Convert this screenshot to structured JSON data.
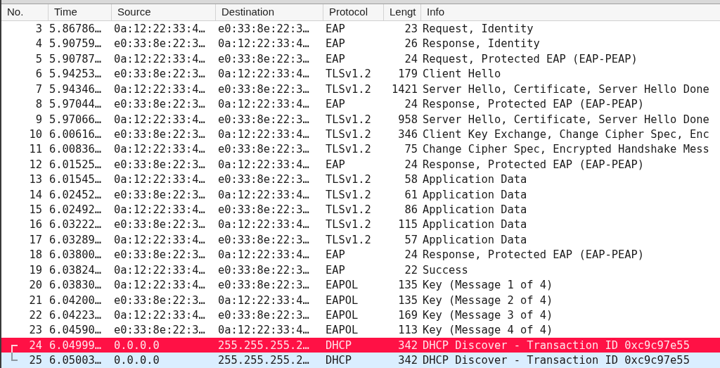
{
  "table": {
    "columns": [
      "No.",
      "Time",
      "Source",
      "Destination",
      "Protocol",
      "Lengt",
      "Info"
    ],
    "rows": [
      {
        "no": "3",
        "time": "5.86786…",
        "source": "0a:12:22:33:4…",
        "destination": "e0:33:8e:22:3…",
        "protocol": "EAP",
        "length": "23",
        "info": "Request, Identity",
        "selected": false,
        "color": "#ffffff"
      },
      {
        "no": "4",
        "time": "5.90759…",
        "source": "e0:33:8e:22:3…",
        "destination": "0a:12:22:33:4…",
        "protocol": "EAP",
        "length": "26",
        "info": "Response, Identity",
        "selected": false,
        "color": "#ffffff"
      },
      {
        "no": "5",
        "time": "5.90787…",
        "source": "0a:12:22:33:4…",
        "destination": "e0:33:8e:22:3…",
        "protocol": "EAP",
        "length": "24",
        "info": "Request, Protected EAP (EAP-PEAP)",
        "selected": false,
        "color": "#ffffff"
      },
      {
        "no": "6",
        "time": "5.94253…",
        "source": "e0:33:8e:22:3…",
        "destination": "0a:12:22:33:4…",
        "protocol": "TLSv1.2",
        "length": "179",
        "info": "Client Hello",
        "selected": false,
        "color": "#ffffff"
      },
      {
        "no": "7",
        "time": "5.94346…",
        "source": "0a:12:22:33:4…",
        "destination": "e0:33:8e:22:3…",
        "protocol": "TLSv1.2",
        "length": "1421",
        "info": "Server Hello, Certificate, Server Hello Done",
        "selected": false,
        "color": "#ffffff"
      },
      {
        "no": "8",
        "time": "5.97044…",
        "source": "e0:33:8e:22:3…",
        "destination": "0a:12:22:33:4…",
        "protocol": "EAP",
        "length": "24",
        "info": "Response, Protected EAP (EAP-PEAP)",
        "selected": false,
        "color": "#ffffff"
      },
      {
        "no": "9",
        "time": "5.97066…",
        "source": "0a:12:22:33:4…",
        "destination": "e0:33:8e:22:3…",
        "protocol": "TLSv1.2",
        "length": "958",
        "info": "Server Hello, Certificate, Server Hello Done",
        "selected": false,
        "color": "#ffffff"
      },
      {
        "no": "10",
        "time": "6.00616…",
        "source": "e0:33:8e:22:3…",
        "destination": "0a:12:22:33:4…",
        "protocol": "TLSv1.2",
        "length": "346",
        "info": "Client Key Exchange, Change Cipher Spec, Enc",
        "selected": false,
        "color": "#ffffff"
      },
      {
        "no": "11",
        "time": "6.00836…",
        "source": "0a:12:22:33:4…",
        "destination": "e0:33:8e:22:3…",
        "protocol": "TLSv1.2",
        "length": "75",
        "info": "Change Cipher Spec, Encrypted Handshake Mess",
        "selected": false,
        "color": "#ffffff"
      },
      {
        "no": "12",
        "time": "6.01525…",
        "source": "e0:33:8e:22:3…",
        "destination": "0a:12:22:33:4…",
        "protocol": "EAP",
        "length": "24",
        "info": "Response, Protected EAP (EAP-PEAP)",
        "selected": false,
        "color": "#ffffff"
      },
      {
        "no": "13",
        "time": "6.01545…",
        "source": "0a:12:22:33:4…",
        "destination": "e0:33:8e:22:3…",
        "protocol": "TLSv1.2",
        "length": "58",
        "info": "Application Data",
        "selected": false,
        "color": "#ffffff"
      },
      {
        "no": "14",
        "time": "6.02452…",
        "source": "e0:33:8e:22:3…",
        "destination": "0a:12:22:33:4…",
        "protocol": "TLSv1.2",
        "length": "61",
        "info": "Application Data",
        "selected": false,
        "color": "#ffffff"
      },
      {
        "no": "15",
        "time": "6.02492…",
        "source": "0a:12:22:33:4…",
        "destination": "e0:33:8e:22:3…",
        "protocol": "TLSv1.2",
        "length": "86",
        "info": "Application Data",
        "selected": false,
        "color": "#ffffff"
      },
      {
        "no": "16",
        "time": "6.03222…",
        "source": "e0:33:8e:22:3…",
        "destination": "0a:12:22:33:4…",
        "protocol": "TLSv1.2",
        "length": "115",
        "info": "Application Data",
        "selected": false,
        "color": "#ffffff"
      },
      {
        "no": "17",
        "time": "6.03289…",
        "source": "0a:12:22:33:4…",
        "destination": "e0:33:8e:22:3…",
        "protocol": "TLSv1.2",
        "length": "57",
        "info": "Application Data",
        "selected": false,
        "color": "#ffffff"
      },
      {
        "no": "18",
        "time": "6.03800…",
        "source": "e0:33:8e:22:3…",
        "destination": "0a:12:22:33:4…",
        "protocol": "EAP",
        "length": "24",
        "info": "Response, Protected EAP (EAP-PEAP)",
        "selected": false,
        "color": "#ffffff"
      },
      {
        "no": "19",
        "time": "6.03824…",
        "source": "0a:12:22:33:4…",
        "destination": "e0:33:8e:22:3…",
        "protocol": "EAP",
        "length": "22",
        "info": "Success",
        "selected": false,
        "color": "#ffffff"
      },
      {
        "no": "20",
        "time": "6.03830…",
        "source": "0a:12:22:33:4…",
        "destination": "e0:33:8e:22:3…",
        "protocol": "EAPOL",
        "length": "135",
        "info": "Key (Message 1 of 4)",
        "selected": false,
        "color": "#ffffff"
      },
      {
        "no": "21",
        "time": "6.04200…",
        "source": "e0:33:8e:22:3…",
        "destination": "0a:12:22:33:4…",
        "protocol": "EAPOL",
        "length": "135",
        "info": "Key (Message 2 of 4)",
        "selected": false,
        "color": "#ffffff"
      },
      {
        "no": "22",
        "time": "6.04223…",
        "source": "0a:12:22:33:4…",
        "destination": "e0:33:8e:22:3…",
        "protocol": "EAPOL",
        "length": "169",
        "info": "Key (Message 3 of 4)",
        "selected": false,
        "color": "#ffffff"
      },
      {
        "no": "23",
        "time": "6.04590…",
        "source": "e0:33:8e:22:3…",
        "destination": "0a:12:22:33:4…",
        "protocol": "EAPOL",
        "length": "113",
        "info": "Key (Message 4 of 4)",
        "selected": false,
        "color": "#ffffff"
      },
      {
        "no": "24",
        "time": "6.04999…",
        "source": "0.0.0.0",
        "destination": "255.255.255.2…",
        "protocol": "DHCP",
        "length": "342",
        "info": "DHCP Discover - Transaction ID 0xc9c97e55",
        "selected": true,
        "kind": "related-start"
      },
      {
        "no": "25",
        "time": "6.05003…",
        "source": "0.0.0.0",
        "destination": "255.255.255.2…",
        "protocol": "DHCP",
        "length": "342",
        "info": "DHCP Discover - Transaction ID 0xc9c97e55",
        "selected": false,
        "color": "#daeeff",
        "kind": "related-end"
      }
    ]
  }
}
